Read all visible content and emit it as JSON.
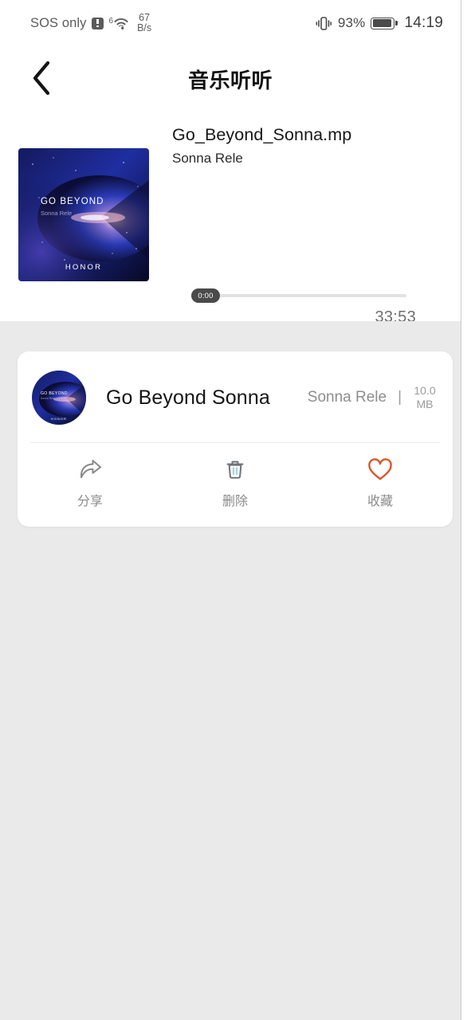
{
  "status_bar": {
    "carrier": "SOS only",
    "warning_icon": "warning-icon",
    "wifi_generation": "6",
    "wifi_icon": "wifi-icon",
    "net_speed_value": "67",
    "net_speed_unit": "B/s",
    "vibrate_icon": "vibrate-icon",
    "battery_percent": "93%",
    "battery_icon": "battery-icon",
    "time": "14:19"
  },
  "header": {
    "back_icon": "back-chevron-icon",
    "title": "音乐听听"
  },
  "player": {
    "album_art": {
      "icon": "album-art-image",
      "title": "GO BEYOND",
      "subtitle": "Sonna Rele",
      "brand": "HONOR"
    },
    "track_name": "Go_Beyond_Sonna.mp",
    "artist": "Sonna Rele",
    "current_time": "0:00",
    "duration": "33:53",
    "progress_percent": 0,
    "play_icon": "play-circle-icon",
    "play_color": "#5a5fa8"
  },
  "file_card": {
    "thumbnail_icon": "album-thumbnail-image",
    "title": "Go Beyond Sonna",
    "artist": "Sonna Rele",
    "separator": "|",
    "size": "10.0 MB",
    "size_value": "10.0",
    "size_unit": "MB",
    "actions": [
      {
        "label": "分享",
        "icon": "share-icon",
        "color": "#8a8a8a"
      },
      {
        "label": "删除",
        "icon": "trash-icon",
        "color": "#6f7378"
      },
      {
        "label": "收藏",
        "icon": "heart-icon",
        "color": "#d9562b"
      }
    ]
  },
  "colors": {
    "background": "#eaeaea",
    "card": "#ffffff",
    "accent_play": "#5a5fa8",
    "accent_favorite": "#d9562b"
  }
}
